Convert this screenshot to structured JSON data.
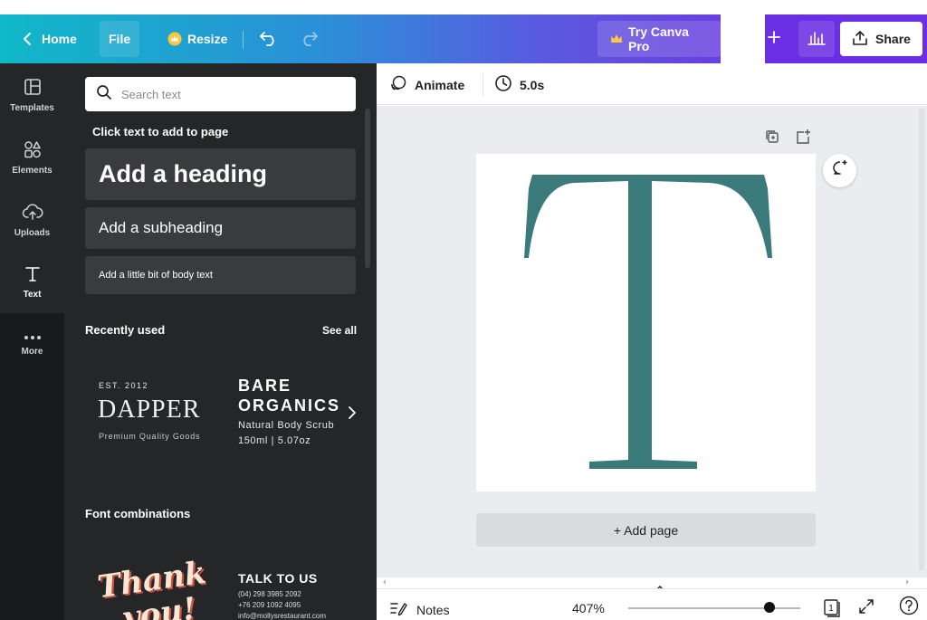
{
  "header": {
    "home_label": "Home",
    "file_label": "File",
    "resize_label": "Resize",
    "try_pro_label": "Try Canva Pro",
    "share_label": "Share",
    "accent_start": "#10b8c8",
    "accent_end": "#6b2fe3"
  },
  "rail": {
    "items": [
      {
        "label": "Templates",
        "icon": "templates-icon"
      },
      {
        "label": "Elements",
        "icon": "elements-icon"
      },
      {
        "label": "Uploads",
        "icon": "upload-cloud-icon"
      },
      {
        "label": "Text",
        "icon": "text-icon"
      },
      {
        "label": "More",
        "icon": "more-dots-icon"
      }
    ],
    "active": "Text"
  },
  "panel": {
    "search_placeholder": "Search text",
    "hint": "Click text to add to page",
    "add_heading": "Add a heading",
    "add_subheading": "Add a subheading",
    "add_body": "Add a little bit of body text",
    "recently_used": "Recently used",
    "see_all": "See all",
    "dapper": {
      "est": "EST. 2012",
      "title": "DAPPER",
      "sub": "Premium Quality Goods"
    },
    "bare": {
      "line1": "BARE",
      "line2": "ORGANICS",
      "line3": "Natural Body Scrub",
      "line4": "150ml | 5.07oz"
    },
    "font_combinations": "Font combinations",
    "thank": {
      "line1": "Thank",
      "line2": "you!"
    },
    "talk": {
      "title": "TALK TO US",
      "lines": [
        "(04) 298 3985 2092",
        "+76 209 1092 4095",
        "info@mollysrestaurant.com"
      ]
    }
  },
  "toolbar": {
    "animate_label": "Animate",
    "duration_label": "5.0s"
  },
  "canvas": {
    "letter": "T",
    "letter_color": "#3b7a7a",
    "add_page_label": "+ Add page"
  },
  "footer": {
    "notes_label": "Notes",
    "zoom_label": "407%",
    "zoom_fraction": 0.82,
    "page_count": "1"
  }
}
